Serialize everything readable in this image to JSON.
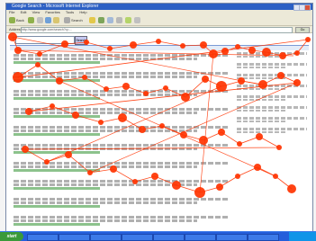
{
  "window": {
    "title": "Google Search - Microsoft Internet Explorer"
  },
  "menu": [
    "File",
    "Edit",
    "View",
    "Favorites",
    "Tools",
    "Help"
  ],
  "toolbar": {
    "back_label": "Back",
    "search_label": "Search",
    "favorites_label": "Favorites"
  },
  "address": {
    "label": "Address",
    "value": "http://www.google.com/search?q=...",
    "go_label": "Go"
  },
  "search": {
    "value": "",
    "button_label": "Search"
  },
  "results_bar": {
    "text": ""
  },
  "results": [
    {
      "title": "",
      "has_snippet": true
    },
    {
      "title": "",
      "has_snippet": true
    },
    {
      "title": "",
      "has_snippet": true
    },
    {
      "title": "",
      "has_snippet": true
    },
    {
      "title": "",
      "has_snippet": true
    },
    {
      "title": "",
      "has_snippet": true
    },
    {
      "title": "",
      "has_snippet": true
    },
    {
      "title": "",
      "has_snippet": true
    },
    {
      "title": "",
      "has_snippet": true
    },
    {
      "title": "",
      "has_snippet": true
    }
  ],
  "ads": [
    {
      "title": ""
    },
    {
      "title": ""
    },
    {
      "title": ""
    },
    {
      "title": ""
    },
    {
      "title": ""
    },
    {
      "title": ""
    },
    {
      "title": ""
    },
    {
      "title": ""
    }
  ],
  "gaze_overlay": {
    "color": "#ff3300",
    "fixation_count": 60
  },
  "taskbar": {
    "start_label": "start",
    "items": [
      "",
      "",
      "",
      "",
      "",
      "",
      "",
      ""
    ],
    "clock": ""
  },
  "icons": [
    "back-icon",
    "forward-icon",
    "stop-icon",
    "refresh-icon",
    "home-icon",
    "search-icon",
    "favorites-icon",
    "history-icon",
    "mail-icon",
    "print-icon"
  ]
}
